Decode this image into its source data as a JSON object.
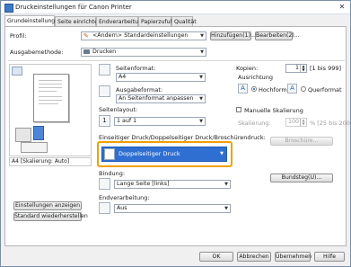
{
  "window": {
    "title": "Druckeinstellungen für Canon Printer",
    "close_glyph": "✕"
  },
  "tabs": [
    "Grundeinstellungen",
    "Seite einrichten",
    "Endverarbeitung",
    "Papierzufuhr",
    "Qualität"
  ],
  "profile": {
    "label": "Profil:",
    "value": "<Ändern> Standardeinstellungen",
    "add_button": "Hinzufügen(1)...",
    "edit_button": "Bearbeiten(2)..."
  },
  "output": {
    "label": "Ausgabemethode:",
    "value": "Drucken"
  },
  "page_size": {
    "label": "Seitenformat:",
    "value": "A4"
  },
  "output_size": {
    "label": "Ausgabeformat:",
    "value": "An Seitenformat anpassen"
  },
  "copies": {
    "label": "Kopien:",
    "value": "1",
    "range": "[1 bis 999]"
  },
  "orientation": {
    "label": "Ausrichtung",
    "portrait": "Hochformat",
    "landscape": "Querformat",
    "selected": "Hochformat",
    "icon_letter": "A"
  },
  "page_layout": {
    "label": "Seitenlayout:",
    "value": "1 auf 1",
    "icon_text": "1"
  },
  "manual_scaling": {
    "label": "Manuelle Skalierung",
    "scaling_label": "Skalierung:",
    "scaling_value": "100",
    "scaling_range": "% [25 bis 200]"
  },
  "duplex": {
    "label": "Einseitiger Druck/Doppelseitiger Druck/Broschürendruck:",
    "value": "Doppelseitiger Druck",
    "brochure_button": "Broschüre..."
  },
  "binding": {
    "label": "Bindung:",
    "value": "Lange Seite [links]",
    "margin_button": "Bundsteg(U)..."
  },
  "finishing": {
    "label": "Endverarbeitung:",
    "value": "Aus"
  },
  "preview": {
    "caption": "A4 [Skalierung: Auto]"
  },
  "left_buttons": {
    "show_settings": "Einstellungen anzeigen",
    "restore_defaults": "Standard wiederherstellen"
  },
  "footer": {
    "ok": "OK",
    "cancel": "Abbrechen",
    "apply": "Übernehmen",
    "help": "Hilfe"
  },
  "colors": {
    "accent": "#2f6fd1",
    "highlight": "#f0a000"
  }
}
